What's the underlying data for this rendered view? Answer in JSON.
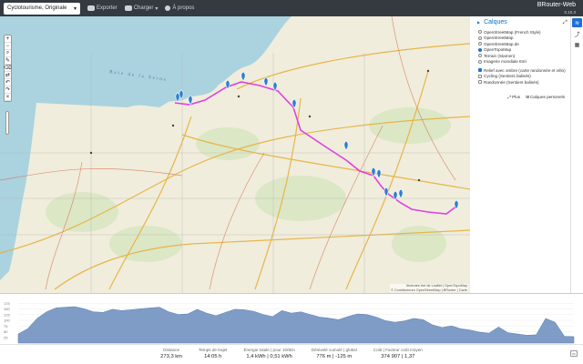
{
  "navbar": {
    "profile": "Cyclotourisme, Originale",
    "export_label": "Exporter",
    "load_label": "Charger",
    "about_label": "À propos",
    "brand": "BRouter-Web",
    "version": "0.10.3"
  },
  "layers": {
    "title": "Calques",
    "base": [
      {
        "label": "OpenStreetMap (French Style)",
        "selected": false
      },
      {
        "label": "OpenStreetMap",
        "selected": false
      },
      {
        "label": "OpenStreetMap.de",
        "selected": false
      },
      {
        "label": "OpenTopoMap",
        "selected": true
      },
      {
        "label": "Terrain (Stamen)",
        "selected": false
      },
      {
        "label": "Imagerie mondiale Esri",
        "selected": false
      }
    ],
    "overlays": [
      {
        "label": "Relief avec ombre (carte randonnée et vélo)",
        "checked": true
      },
      {
        "label": "Cycling (Sentiers balisés)",
        "checked": false
      },
      {
        "label": "Randonnée (Sentiers balisés)",
        "checked": false
      }
    ],
    "more_label": "Plus",
    "custom_label": "Calques personels"
  },
  "map": {
    "sea_label": "Baie de la Seine",
    "attribution_1": "Itinéraire tiré de Leaflet | OpenTopoMap",
    "attribution_2": "© Contributeurs OpenStreetMap | BRouter | Carte"
  },
  "elevation": {
    "y_ticks": [
      "175",
      "150",
      "125",
      "100",
      "75",
      "50",
      "25"
    ],
    "profile": [
      35,
      55,
      95,
      120,
      135,
      138,
      140,
      132,
      120,
      118,
      130,
      125,
      128,
      132,
      135,
      138,
      120,
      110,
      112,
      130,
      115,
      105,
      118,
      130,
      128,
      122,
      110,
      102,
      125,
      115,
      120,
      110,
      100,
      96,
      90,
      102,
      112,
      110,
      100,
      86,
      80,
      85,
      95,
      90,
      70,
      60,
      66,
      55,
      50,
      42,
      38,
      62,
      40,
      35,
      30,
      32,
      95,
      80,
      26,
      25
    ]
  },
  "stats": [
    {
      "label": "Distance",
      "value": "273,3 km"
    },
    {
      "label": "Temps de trajet",
      "value": "14:05 h"
    },
    {
      "label": "Énergie totale | pour 100km",
      "value": "1,4 kWh | 0,51 kWh"
    },
    {
      "label": "Dénivelé cumulé | global",
      "value": "776 m | -125 m"
    },
    {
      "label": "Coût | Facteur coût moyen",
      "value": "374 907 | 1,37"
    }
  ],
  "colors": {
    "navbar": "#343a40",
    "accent": "#1e6fd9",
    "route": "#e040e0",
    "marker": "#2c7fd0",
    "elevation_fill": "#7f9cc7"
  }
}
